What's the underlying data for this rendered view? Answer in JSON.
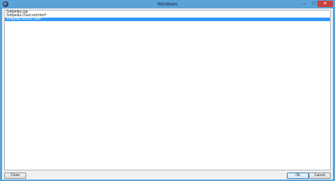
{
  "window": {
    "title": "Windows",
    "minimize_glyph": "–",
    "maximize_glyph": "□",
    "close_glyph": "✕"
  },
  "list": {
    "items": [
      {
        "label": "Softpedia.cpp",
        "selected": false
      },
      {
        "label": "Softpedia Chart.xml.html*",
        "selected": false
      },
      {
        "label": "softpedia source code",
        "selected": true
      }
    ]
  },
  "buttons": {
    "close_label": "Close",
    "ok_label": "Ok",
    "cancel_label": "Cancel"
  }
}
